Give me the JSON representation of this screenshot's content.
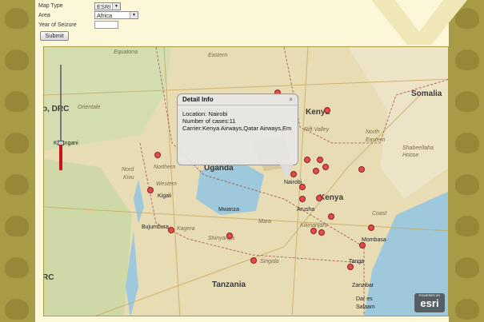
{
  "form": {
    "map_type_label": "Map Type",
    "map_type_value": "ESRI",
    "area_label": "Area",
    "area_value": "Africa",
    "year_label": "Year of Seizure",
    "year_value": "",
    "submit_label": "Submit"
  },
  "map": {
    "labels": [
      {
        "text": "Somalia",
        "cls": "country"
      },
      {
        "text": "Kenya",
        "cls": "country"
      },
      {
        "text": "Kenya",
        "cls": "country"
      },
      {
        "text": "Tanzania",
        "cls": "country"
      },
      {
        "text": "o, DRC",
        "cls": "country"
      },
      {
        "text": "RC",
        "cls": "country"
      },
      {
        "text": "Uganda",
        "cls": "country"
      },
      {
        "text": "Equatoria",
        "cls": "region"
      },
      {
        "text": "Eastern",
        "cls": "region"
      },
      {
        "text": "Orientale",
        "cls": "region"
      },
      {
        "text": "Rift Valley",
        "cls": "region"
      },
      {
        "text": "North",
        "cls": "region"
      },
      {
        "text": "Eastern",
        "cls": "region"
      },
      {
        "text": "Shabeellaha",
        "cls": "region"
      },
      {
        "text": "Hoose",
        "cls": "region"
      },
      {
        "text": "Nord",
        "cls": "region"
      },
      {
        "text": "Kivu",
        "cls": "region"
      },
      {
        "text": "Northern",
        "cls": "region"
      },
      {
        "text": "Western",
        "cls": "region"
      },
      {
        "text": "Kagera",
        "cls": "region"
      },
      {
        "text": "Mara",
        "cls": "region"
      },
      {
        "text": "Shinyanga",
        "cls": "region"
      },
      {
        "text": "Singida",
        "cls": "region"
      },
      {
        "text": "Kilimanjaro",
        "cls": "region"
      },
      {
        "text": "Coast",
        "cls": "region"
      },
      {
        "text": "Kisangani",
        "cls": "city"
      },
      {
        "text": "Kigali",
        "cls": "city"
      },
      {
        "text": "Bujumbura",
        "cls": "city"
      },
      {
        "text": "Mwanza",
        "cls": "city"
      },
      {
        "text": "Nairobi",
        "cls": "city"
      },
      {
        "text": "Mombasa",
        "cls": "city"
      },
      {
        "text": "Tanga",
        "cls": "city"
      },
      {
        "text": "Zanzibar",
        "cls": "city"
      },
      {
        "text": "Dar es",
        "cls": "city"
      },
      {
        "text": "Salaam",
        "cls": "city"
      },
      {
        "text": "Arusha",
        "cls": "city"
      }
    ],
    "markers": 22,
    "esri_powered": "POWERED BY",
    "esri_name": "esri"
  },
  "popup": {
    "title": "Detail Info",
    "location": "Location: Nairobi",
    "cases": "Number of cases:11",
    "carrier": "Carrier:Kenya Airways,Qatar Airways,Em"
  },
  "colors": {
    "marker": "#e64b4b",
    "background_olive": "#a89b45",
    "panel": "#fbf7d8"
  }
}
